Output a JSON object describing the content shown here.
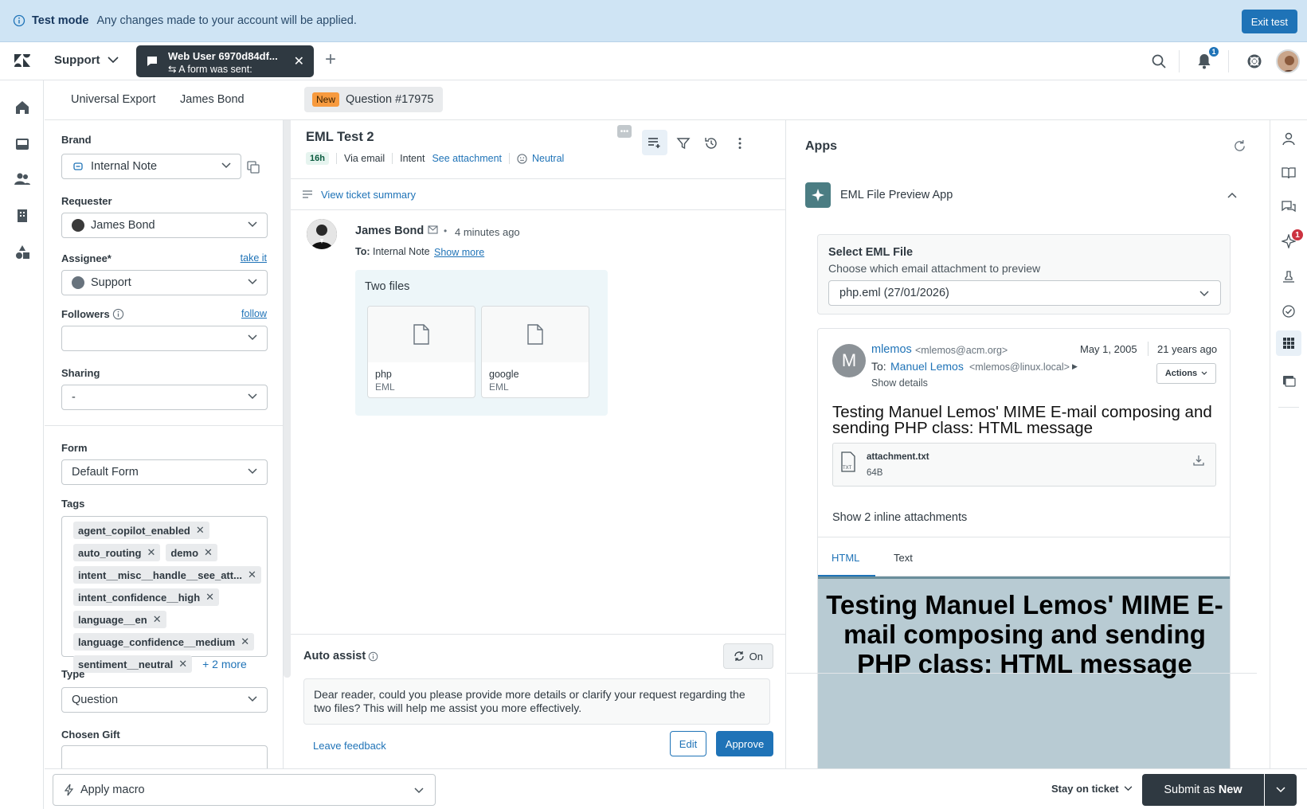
{
  "banner": {
    "label": "Test mode",
    "message": "Any changes made to your account will be applied.",
    "exit_label": "Exit test"
  },
  "topnav": {
    "product": "Support",
    "tab_title": "Web User 6970d84df...",
    "tab_subtitle": "A form was sent:",
    "notification_count": "1"
  },
  "subtabs": {
    "items": [
      "Universal Export",
      "James Bond"
    ],
    "active_badge": "New",
    "active_label": "Question #17975"
  },
  "props": {
    "brand_label": "Brand",
    "brand_value": "Internal Note",
    "requester_label": "Requester",
    "requester_value": "James Bond",
    "assignee_label": "Assignee*",
    "assignee_link": "take it",
    "assignee_value": "Support",
    "followers_label": "Followers",
    "followers_link": "follow",
    "sharing_label": "Sharing",
    "sharing_value": "-",
    "form_label": "Form",
    "form_value": "Default Form",
    "tags_label": "Tags",
    "tags": [
      [
        "agent_copilot_enabled"
      ],
      [
        "auto_routing",
        "demo"
      ],
      [
        "intent__misc__handle__see_att..."
      ],
      [
        "intent_confidence__high"
      ],
      [
        "language__en"
      ],
      [
        "language_confidence__medium"
      ],
      [
        "sentiment__neutral"
      ]
    ],
    "tags_more": "+ 2 more",
    "type_label": "Type",
    "type_value": "Question",
    "gift_label": "Chosen Gift"
  },
  "conversation": {
    "title": "EML Test 2",
    "time_badge": "16h",
    "channel": "Via email",
    "intent_label": "Intent",
    "intent_value": "See attachment",
    "sentiment": "Neutral",
    "summary_link": "View ticket summary",
    "author": "James Bond",
    "time": "4 minutes ago",
    "to_label": "To:",
    "to_value": "Internal Note",
    "show_more": "Show more",
    "attach_title": "Two files",
    "files": [
      {
        "name": "php",
        "ext": "EML"
      },
      {
        "name": "google",
        "ext": "EML"
      }
    ]
  },
  "autoassist": {
    "title": "Auto assist",
    "toggle": "On",
    "text": "Dear reader, could you please provide more details or clarify your request regarding the two files? This will help me assist you more effectively.",
    "feedback": "Leave feedback",
    "edit": "Edit",
    "approve": "Approve"
  },
  "apps": {
    "title": "Apps",
    "app_name": "EML File Preview App",
    "select_title": "Select EML File",
    "select_desc": "Choose which email attachment to preview",
    "select_value": "php.eml (27/01/2026)",
    "email": {
      "avatar_letter": "M",
      "from_name": "mlemos",
      "from_addr": "<mlemos@acm.org>",
      "date": "May 1, 2005",
      "ago": "21 years ago",
      "to_label": "To:",
      "to_name": "Manuel Lemos",
      "to_addr": "<mlemos@linux.local>",
      "show_details": "Show details",
      "actions": "Actions",
      "subject": "Testing Manuel Lemos' MIME E-mail composing and sending PHP class: HTML message",
      "attachment_name": "attachment.txt",
      "attachment_size": "64B",
      "attachment_type": "TXT",
      "inline_link": "Show 2 inline attachments",
      "tab_html": "HTML",
      "tab_text": "Text",
      "preview_heading": "Testing Manuel Lemos' MIME E-mail composing and sending PHP class: HTML message"
    }
  },
  "rightrail": {
    "badge": "1"
  },
  "bottombar": {
    "macro": "Apply macro",
    "stay": "Stay on ticket",
    "submit_prefix": "Submit as ",
    "submit_status": "New"
  },
  "colors": {
    "primary": "#1f73b7",
    "dark": "#2f3941",
    "banner": "#cfe4f4",
    "new_badge": "#f79a3e",
    "notification": "#cc3340"
  }
}
